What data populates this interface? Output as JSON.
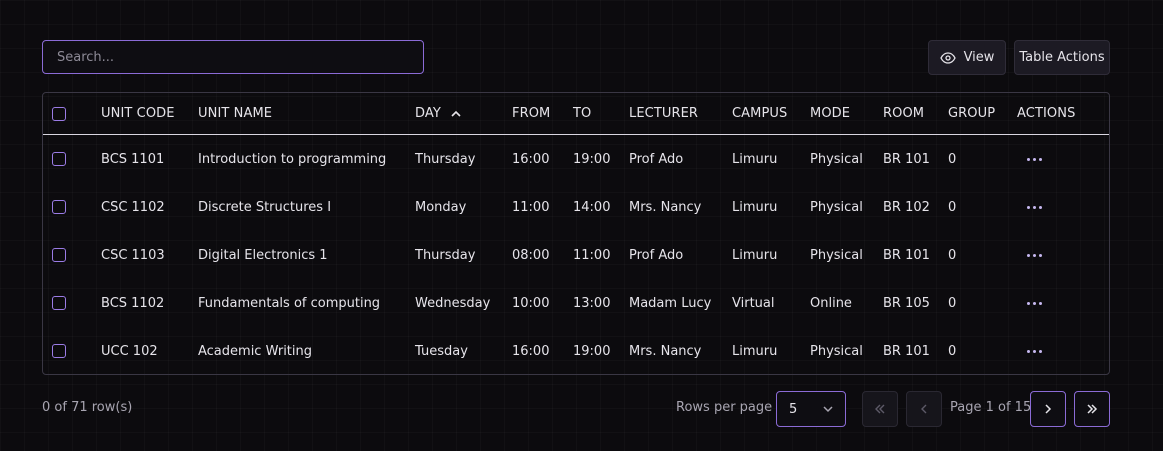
{
  "search": {
    "placeholder": "Search..."
  },
  "toolbar": {
    "view_label": "View",
    "table_actions_label": "Table Actions"
  },
  "table": {
    "columns": [
      "UNIT CODE",
      "UNIT NAME",
      "DAY",
      "FROM",
      "TO",
      "LECTURER",
      "CAMPUS",
      "MODE",
      "ROOM",
      "GROUP",
      "ACTIONS"
    ],
    "sorted_column": "DAY",
    "sort_direction": "ascending",
    "rows": [
      [
        "BCS 1101",
        "Introduction to programming",
        "Thursday",
        "16:00",
        "19:00",
        "Prof Ado",
        "Limuru",
        "Physical",
        "BR 101",
        "0"
      ],
      [
        "CSC 1102",
        "Discrete Structures I",
        "Monday",
        "11:00",
        "14:00",
        "Mrs. Nancy",
        "Limuru",
        "Physical",
        "BR 102",
        "0"
      ],
      [
        "CSC 1103",
        "Digital Electronics 1",
        "Thursday",
        "08:00",
        "11:00",
        "Prof Ado",
        "Limuru",
        "Physical",
        "BR 101",
        "0"
      ],
      [
        "BCS 1102",
        "Fundamentals of computing",
        "Wednesday",
        "10:00",
        "13:00",
        "Madam Lucy",
        "Virtual",
        "Online",
        "BR 105",
        "0"
      ],
      [
        "UCC 102",
        "Academic Writing",
        "Tuesday",
        "16:00",
        "19:00",
        "Mrs. Nancy",
        "Limuru",
        "Physical",
        "BR 101",
        "0"
      ]
    ]
  },
  "footer": {
    "selection_count": "0 of 71 row(s)",
    "rows_per_page_label": "Rows per page",
    "rows_per_page_value": "5",
    "page_info": "Page 1 of 15"
  },
  "icons": {
    "view": "eye-icon",
    "sort": "chevron-up-icon",
    "row_actions": "more-horizontal-icon",
    "select": "chevron-down-icon",
    "first": "chevrons-left-icon",
    "prev": "chevron-left-icon",
    "next": "chevron-right-icon",
    "last": "chevrons-right-icon"
  },
  "colors": {
    "accent": "#8b6bd6",
    "background": "#0c0b0e"
  }
}
